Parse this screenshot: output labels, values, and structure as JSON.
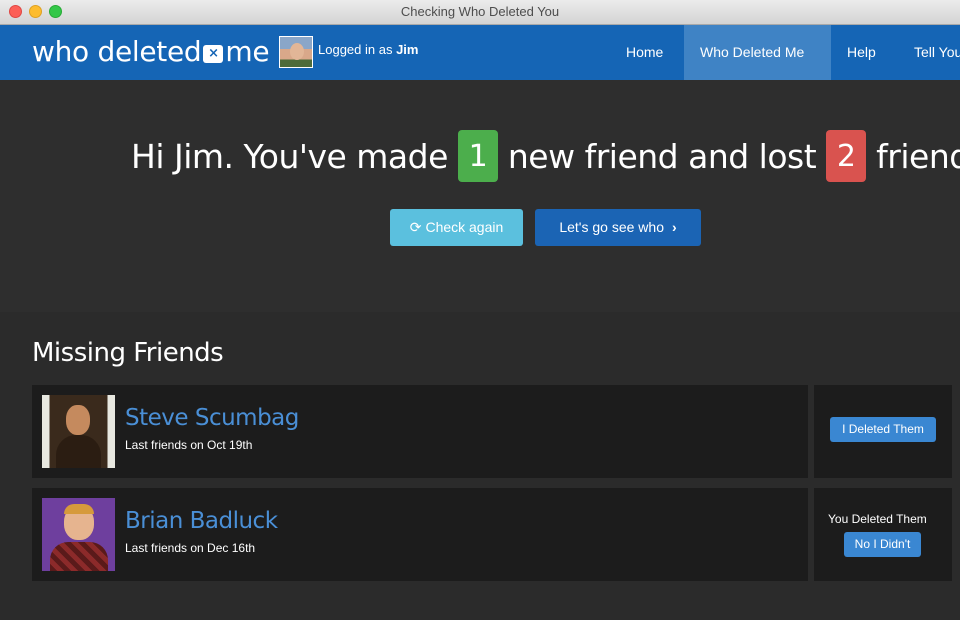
{
  "window": {
    "title": "Checking Who Deleted You"
  },
  "navbar": {
    "logo_left": "who deleted",
    "logo_x": "×",
    "logo_right": "me",
    "logged_prefix": "Logged in as",
    "user": "Jim",
    "items": [
      "Home",
      "Who Deleted Me",
      "Help",
      "Tell You"
    ]
  },
  "hero": {
    "part1": "Hi Jim. You've made",
    "new_count": "1",
    "part2": "new friend and lost",
    "lost_count": "2",
    "part3": "friends.",
    "check_again": "Check again",
    "lets_go": "Let's go see who"
  },
  "missing": {
    "title": "Missing Friends",
    "friends": [
      {
        "name": "Steve Scumbag",
        "sub": "Last friends on Oct 19th",
        "action": "I Deleted Them"
      },
      {
        "name": "Brian Badluck",
        "sub": "Last friends on Dec 16th",
        "status": "You Deleted Them",
        "action": "No I Didn't"
      }
    ]
  },
  "colors": {
    "nav": "#1565b5",
    "nav_active": "#3f83c5",
    "green": "#4cae4c",
    "red": "#d9534f",
    "info": "#5bc0de",
    "link": "#4a8fd6"
  }
}
